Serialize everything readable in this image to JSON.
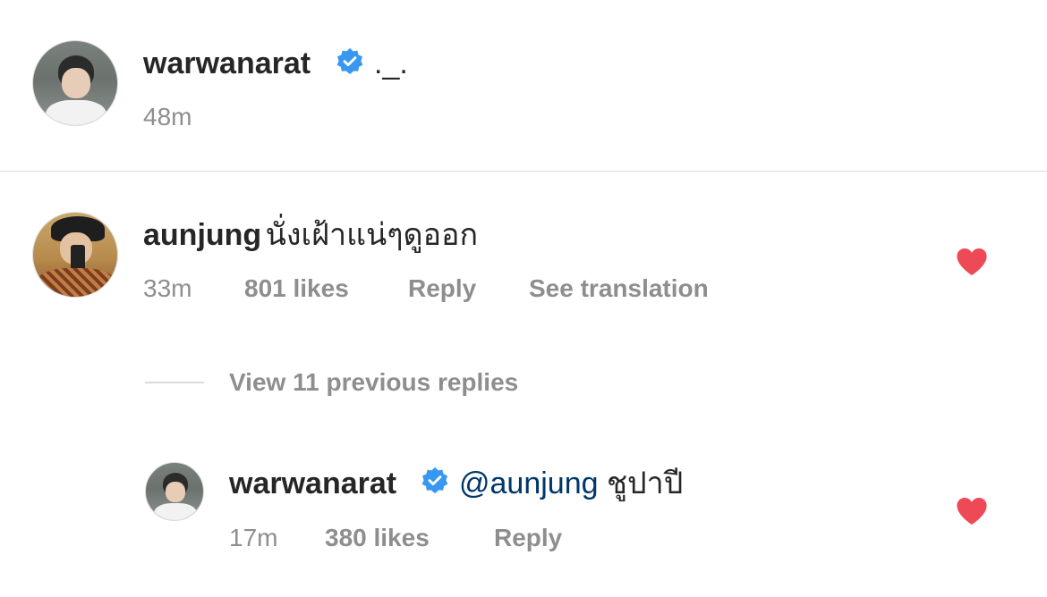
{
  "caption": {
    "username": "warwanarat",
    "text": "._.",
    "time": "48m"
  },
  "comment": {
    "username": "aunjung",
    "text": "นั่งเฝ้าแน่ๆดูออก",
    "time": "33m",
    "likes": "801 likes",
    "reply_label": "Reply",
    "translate_label": "See translation",
    "liked": true
  },
  "view_replies_label": "View 11 previous replies",
  "reply": {
    "username": "warwanarat",
    "mention": "@aunjung",
    "text": "ชูปาปี",
    "time": "17m",
    "likes": "380 likes",
    "reply_label": "Reply",
    "liked": true
  },
  "colors": {
    "verified_blue": "#3897f0",
    "heart_red": "#ed4956",
    "mention_blue": "#00376b",
    "meta_gray": "#8e8e8e"
  },
  "icons": {
    "verified": "verified-badge-icon",
    "like": "heart-filled-icon"
  }
}
